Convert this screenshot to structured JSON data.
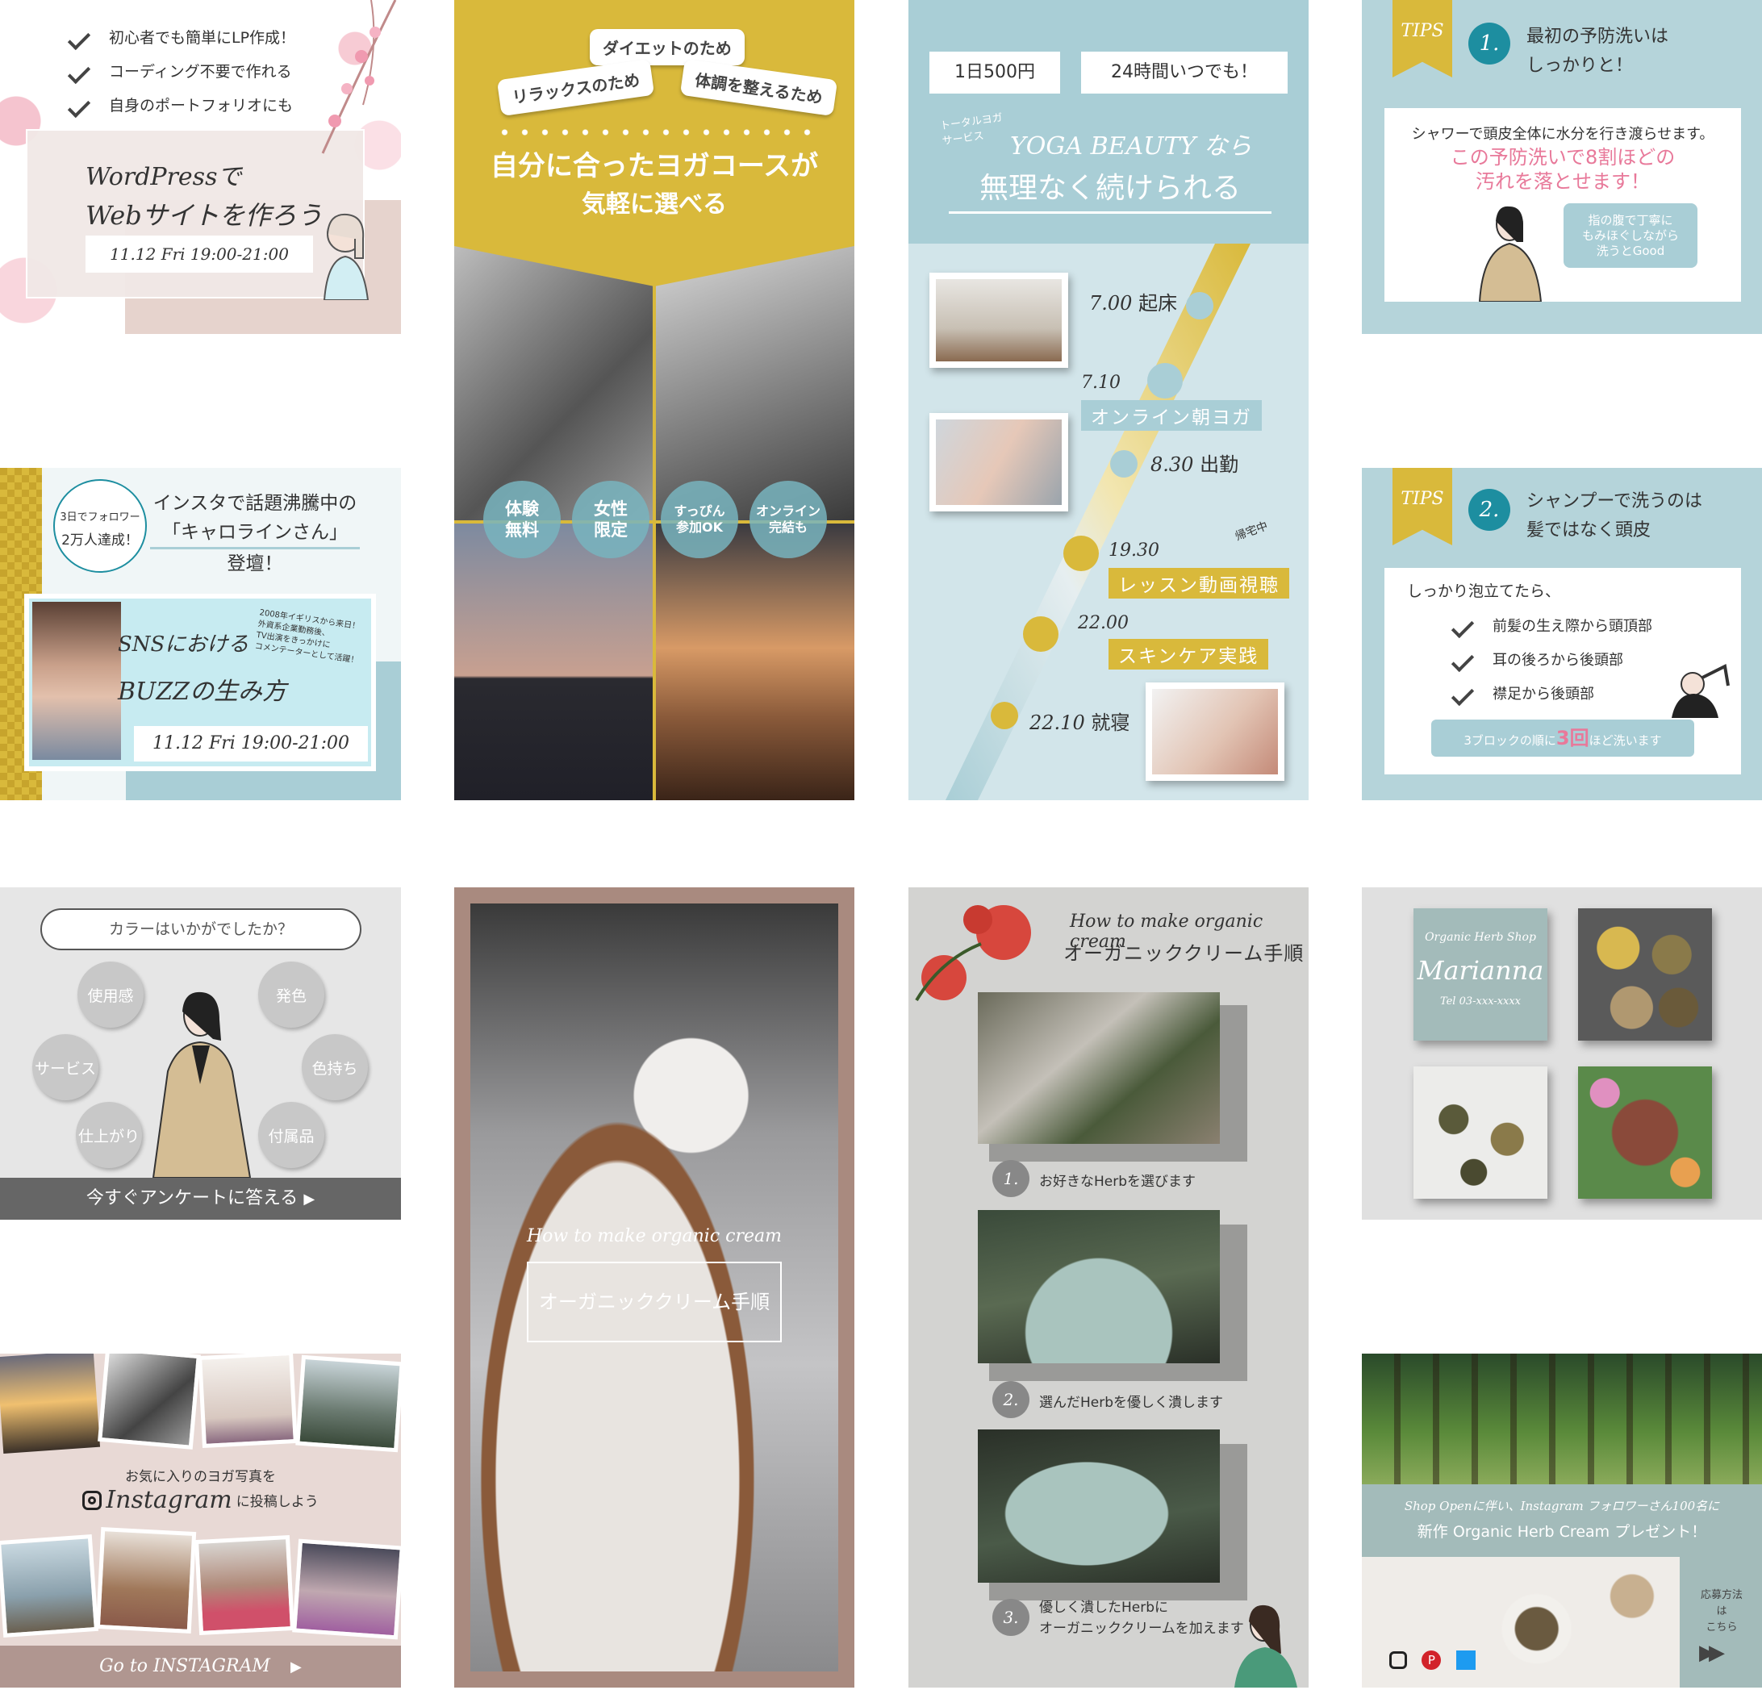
{
  "wp": {
    "checks": [
      "初心者でも簡単にLP作成！",
      "コーディング不要で作れる",
      "自身のポートフォリオにも"
    ],
    "title_1": "WordPressで",
    "title_2": "Webサイトを作ろう",
    "date": "11.12 Fri 19:00-21:00"
  },
  "yoga_course": {
    "bubbles": [
      "ダイエットのため",
      "リラックスのため",
      "体調を整えるため"
    ],
    "headline_1": "自分に合ったヨガコースが",
    "headline_2": "気軽に選べる",
    "circles": [
      "体験\n無料",
      "女性\n限定",
      "すっぴん\n参加OK",
      "オンライン\n完結も"
    ]
  },
  "yoga_beauty": {
    "price": "1日500円",
    "anytime": "24時間いつでも！",
    "service_label": "トータルヨガ\nサービス",
    "brand_line": "YOGA BEAUTY なら",
    "tagline": "無理なく続けられる",
    "schedule": [
      {
        "time": "7.00",
        "label": "起床"
      },
      {
        "time": "7.10",
        "label": "オンライン朝ヨガ"
      },
      {
        "time": "8.30",
        "label": "出勤"
      },
      {
        "time": "19.30",
        "label": "レッスン動画視聴"
      },
      {
        "time": "22.00",
        "label": "スキンケア実践"
      },
      {
        "time": "22.10",
        "label": "就寝"
      }
    ],
    "note": "帰宅中"
  },
  "tips1": {
    "tag": "TIPS",
    "num": "1.",
    "title": "最初の予防洗いは\nしっかりと！",
    "body": "シャワーで頭皮全体に水分を行き渡らせます。",
    "highlight": "この予防洗いで8割ほどの\n汚れを落とせます！",
    "bubble": "指の腹で丁寧に\nもみほぐしながら\n洗うとGood"
  },
  "carolyn": {
    "badge_1": "3日でフォロワー",
    "badge_2": "2万人達成！",
    "head_1": "インスタで話題沸騰中の",
    "head_2": "「キャロラインさん」",
    "head_3": "登壇！",
    "title_1": "SNSにおける",
    "title_2": "BUZZの生み方",
    "side": "2008年イギリスから来日！\n外資系企業勤務後、\nTV出演をきっかけに\nコメンテーターとして活躍！",
    "date": "11.12 Fri 19:00-21:00"
  },
  "tips2": {
    "tag": "TIPS",
    "num": "2.",
    "title": "シャンプーで洗うのは\n髪ではなく頭皮",
    "lead": "しっかり泡立てたら、",
    "checks": [
      "前髪の生え際から頭頂部",
      "耳の後ろから後頭部",
      "襟足から後頭部"
    ],
    "bottom_1": "3ブロックの順に",
    "bottom_2": "3回",
    "bottom_3": "ほど洗います"
  },
  "survey": {
    "question": "カラーはいかがでしたか？",
    "options": [
      "使用感",
      "発色",
      "サービス",
      "色持ち",
      "仕上がり",
      "付属品"
    ],
    "cta": "今すぐアンケートに答える"
  },
  "cream_cover": {
    "en": "How to make organic cream",
    "jp": "オーガニッククリーム手順"
  },
  "cream_steps": {
    "en": "How to make organic cream",
    "jp": "オーガニッククリーム手順",
    "steps": [
      {
        "n": "1.",
        "text": "お好きなHerbを選びます"
      },
      {
        "n": "2.",
        "text": "選んだHerbを優しく潰します"
      },
      {
        "n": "3.",
        "text": "優しく潰したHerbに\nオーガニッククリームを加えます"
      }
    ]
  },
  "herb_shop": {
    "label": "Organic Herb Shop",
    "name": "Marianna",
    "tel": "Tel 03-xxx-xxxx"
  },
  "insta_yoga": {
    "line_1": "お気に入りのヨガ写真を",
    "brand": "Instagram",
    "line_2": "に投稿しよう",
    "cta": "Go to INSTAGRAM"
  },
  "herb_campaign": {
    "line_1": "Shop Openに伴い、Instagram フォロワーさん100名に",
    "line_2": "新作 Organic Herb Cream プレゼント！",
    "side": "応募方法\nは\nこちら"
  },
  "colors": {
    "gold": "#d9b93b",
    "teal": "#b5d4da",
    "pink": "#e8799a",
    "accent": "#1d8ea0"
  }
}
